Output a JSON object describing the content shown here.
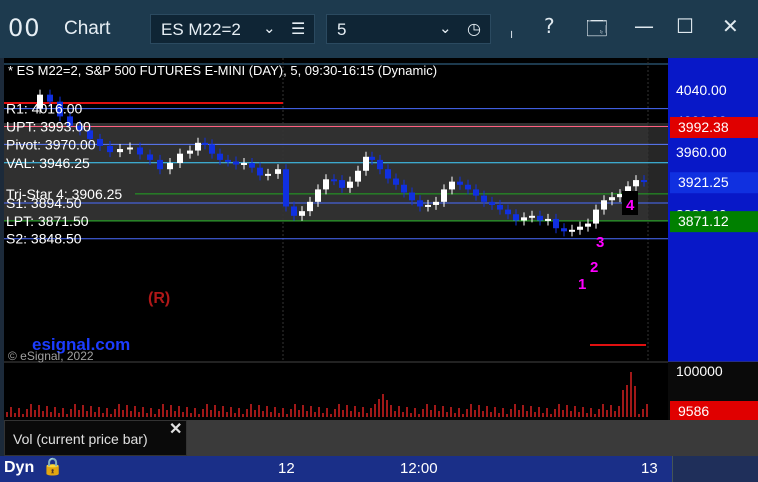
{
  "window": {
    "icon": "00",
    "title": "Chart",
    "symbol": "ES M22=2",
    "interval": "5",
    "help": "?",
    "icons": [
      "chevron-down-icon",
      "menu-lines-icon",
      "clock-icon",
      "pin-icon",
      "help-icon",
      "layout-icon",
      "minimize-icon",
      "maximize-icon",
      "close-icon"
    ]
  },
  "chart": {
    "header": "* ES M22=2, S&P 500 FUTURES E-MINI (DAY), 5, 09:30-16:15 (Dynamic)",
    "copyright": "© eSignal, 2022",
    "watermark": "esignal.com",
    "price_axis": {
      "ticks": [
        "4040.00",
        "4000.00",
        "3960.00",
        "3920.00",
        "3880.00"
      ],
      "markers": [
        {
          "label": "3992.38",
          "color": "#e00000"
        },
        {
          "label": "3921.25",
          "color": "#1030e0"
        },
        {
          "label": "3871.12",
          "color": "#008000"
        }
      ]
    },
    "levels": [
      {
        "label": "R1: 4016.00",
        "price": 4016.0,
        "color": "#4a6cff"
      },
      {
        "label": "UPT: 3993.00",
        "price": 3993.0,
        "color": "#ff6080"
      },
      {
        "label": "Pivot: 3970.00",
        "price": 3970.0,
        "color": "#5b7cff"
      },
      {
        "label": "VAL: 3946.25",
        "price": 3946.25,
        "color": "#40d0ff"
      },
      {
        "label": "Tri-Star 4: 3906.25",
        "price": 3906.25,
        "color": "#22a522"
      },
      {
        "label": "S1: 3894.50",
        "price": 3894.5,
        "color": "#4a6cff"
      },
      {
        "label": "LPT: 3871.50",
        "price": 3871.5,
        "color": "#40d040"
      },
      {
        "label": "S2: 3848.50",
        "price": 3848.5,
        "color": "#4a6cff"
      }
    ],
    "annotations": [
      {
        "text": "(R)",
        "color": "#b01818"
      },
      {
        "text": "1",
        "color": "#ff00ff"
      },
      {
        "text": "2",
        "color": "#ff00ff"
      },
      {
        "text": "3",
        "color": "#ff00ff"
      },
      {
        "text": "4",
        "color": "#ff00ff"
      }
    ],
    "volume_axis": {
      "tick": "100000",
      "marker": "9586",
      "marker_color": "#e00000"
    },
    "volume_label": "Vol (current price bar)",
    "time_axis": [
      "12",
      "12:00",
      "13"
    ]
  },
  "status": {
    "dyn": "Dyn"
  },
  "colors": {
    "titlebar": "#1d3a4e",
    "statusbar": "#1a2f88",
    "up_candle": "#ffffff",
    "down_candle": "#1030e0"
  }
}
